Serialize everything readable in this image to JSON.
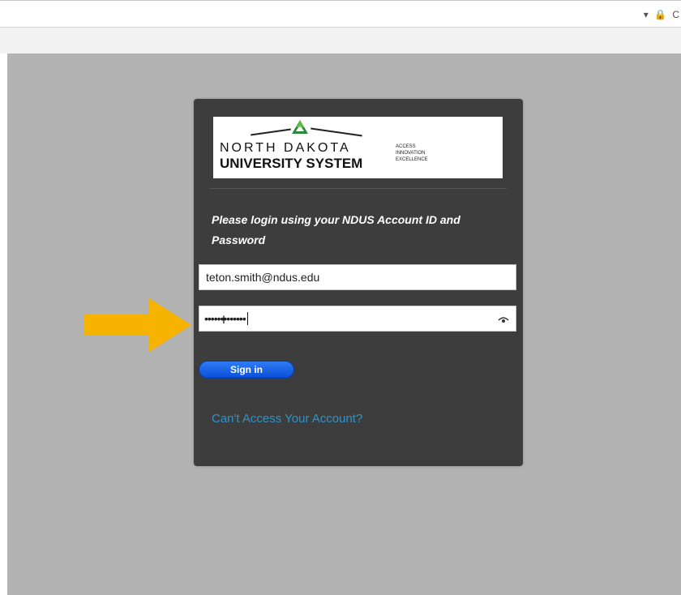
{
  "browser": {
    "toolbar_icons": "▾ 🔒 C"
  },
  "logo": {
    "line1": "NORTH DAKOTA",
    "line2": "UNIVERSITY SYSTEM",
    "tagline": [
      "ACCESS",
      "INNOVATION",
      "EXCELLENCE"
    ]
  },
  "login": {
    "instructions": "Please login using your NDUS Account ID and Password",
    "email_value": "teton.smith@ndus.edu",
    "password_mask": "•••••••••••••",
    "signin_label": "Sign in",
    "cant_access_label": "Can't Access Your Account?"
  },
  "colors": {
    "panel_bg": "#3d3d3d",
    "page_bg": "#b3b3b3",
    "button_blue": "#1463eb",
    "link_blue": "#2e94c9",
    "arrow_yellow": "#f6b400"
  },
  "icons": {
    "reveal_password": "eye-icon",
    "arrow": "arrow-right-icon",
    "lock": "lock-icon"
  }
}
